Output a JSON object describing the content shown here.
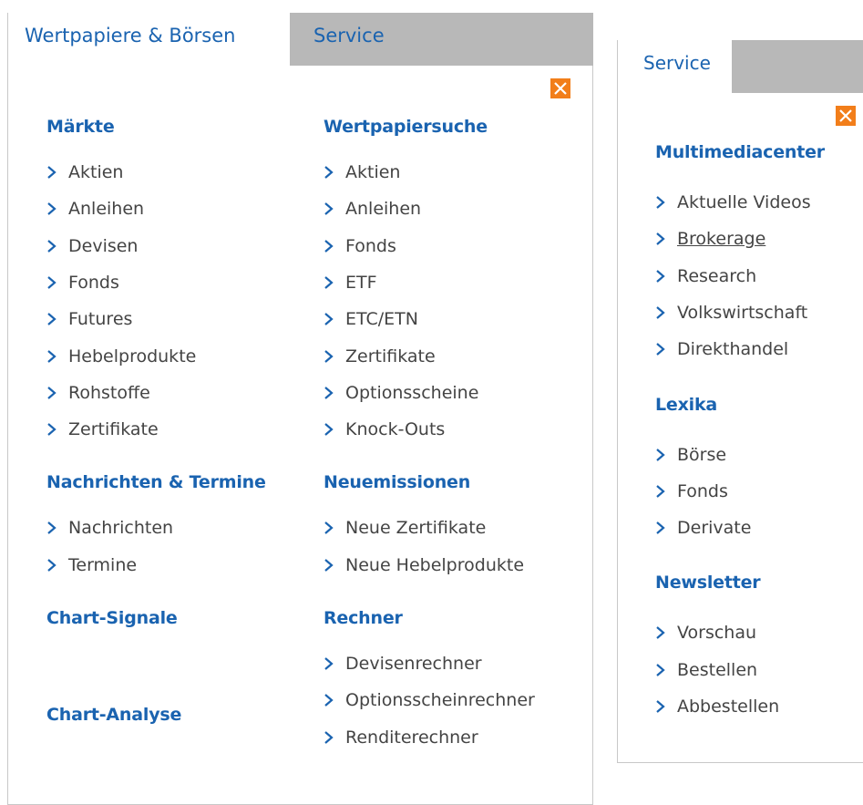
{
  "left_menu": {
    "tabs": [
      {
        "label": "Wertpapiere & Börsen",
        "active": true
      },
      {
        "label": "Service",
        "active": false
      }
    ],
    "close_icon": "close-icon",
    "columns": [
      {
        "sections": [
          {
            "title": "Märkte",
            "items": [
              "Aktien",
              "Anleihen",
              "Devisen",
              "Fonds",
              "Futures",
              "Hebelprodukte",
              "Rohstoffe",
              "Zertifikate"
            ]
          },
          {
            "title": "Nachrichten & Termine",
            "items": [
              "Nachrichten",
              "Termine"
            ]
          },
          {
            "title": "Chart-Signale",
            "items": []
          },
          {
            "title": "Chart-Analyse",
            "items": []
          }
        ]
      },
      {
        "sections": [
          {
            "title": "Wertpapiersuche",
            "items": [
              "Aktien",
              "Anleihen",
              "Fonds",
              "ETF",
              "ETC/ETN",
              "Zertifikate",
              "Optionsscheine",
              "Knock-Outs"
            ]
          },
          {
            "title": "Neuemissionen",
            "items": [
              "Neue Zertifikate",
              "Neue Hebelprodukte"
            ]
          },
          {
            "title": "Rechner",
            "items": [
              "Devisenrechner",
              "Optionsscheinrechner",
              "Renditerechner"
            ]
          }
        ]
      }
    ]
  },
  "right_menu": {
    "tabs": [
      {
        "label": "Service",
        "active": true
      }
    ],
    "close_icon": "close-icon",
    "sections": [
      {
        "title": "Multimediacenter",
        "items": [
          "Aktuelle Videos",
          "Brokerage",
          "Research",
          "Volkswirtschaft",
          "Direkthandel"
        ]
      },
      {
        "title": "Lexika",
        "items": [
          "Börse",
          "Fonds",
          "Derivate"
        ]
      },
      {
        "title": "Newsletter",
        "items": [
          "Vorschau",
          "Bestellen",
          "Abbestellen"
        ]
      }
    ],
    "hovered_item": "Brokerage"
  },
  "colors": {
    "link_blue": "#1a63b0",
    "tab_gray": "#b8b8b8",
    "close_orange": "#f27e1a",
    "item_text": "#444444"
  }
}
